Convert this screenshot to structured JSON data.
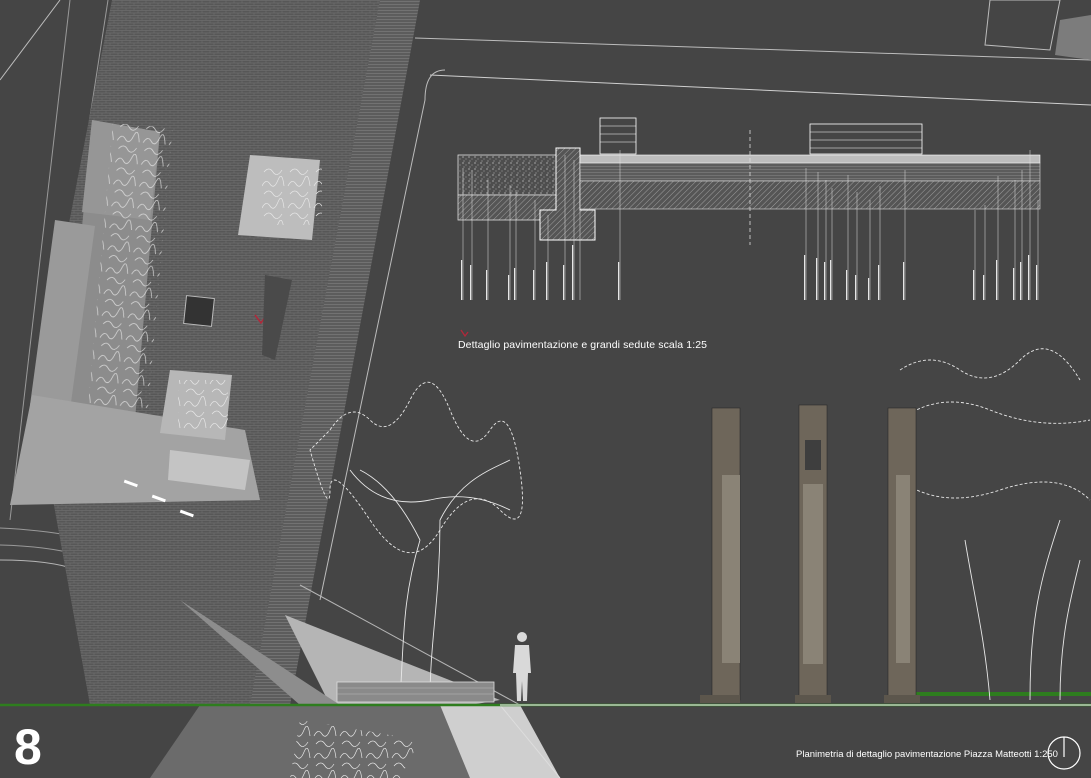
{
  "sheet": {
    "number": "8",
    "section_caption": "Dettaglio pavimentazione e grandi sedute scala 1:25",
    "plan_caption": "Planimetria di dettaglio pavimentazione Piazza Matteotti 1:250",
    "north_arrow": "north-arrow-icon"
  },
  "colors": {
    "background": "#454545",
    "plan_light": "#9b9b9b",
    "plan_mid": "#7a7a7a",
    "paving": "#5a5a5a",
    "grass": "#2e7d1e",
    "accent_red": "#b0283a",
    "seat_concrete": "#6e665a"
  }
}
